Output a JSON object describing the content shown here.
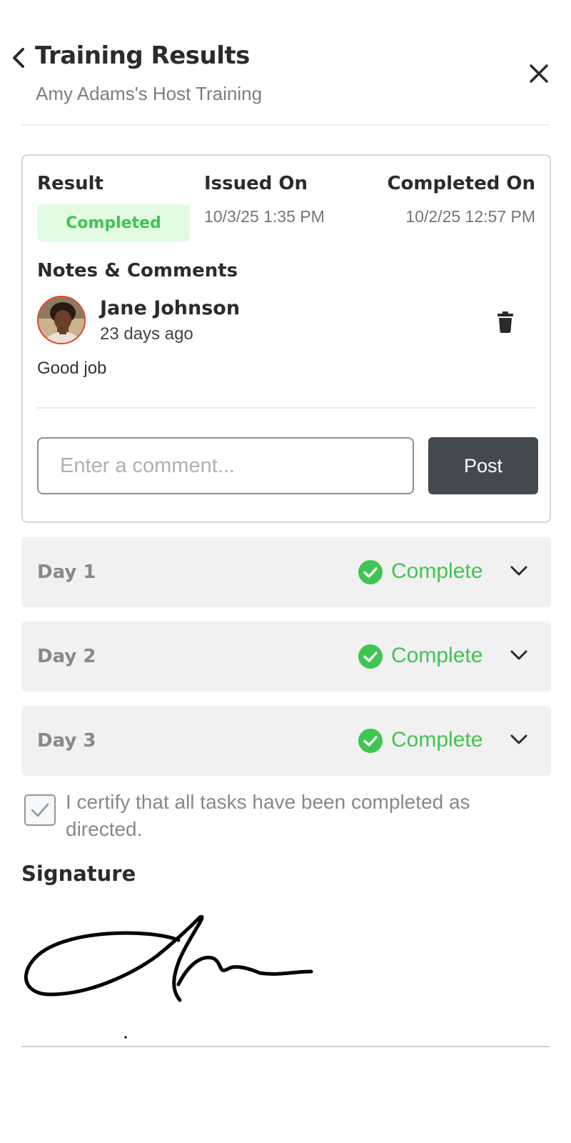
{
  "header": {
    "title": "Training Results",
    "subtitle": "Amy Adams's Host Training",
    "back_icon": "chevron-left-icon",
    "close_icon": "close-icon"
  },
  "result_card": {
    "result_label": "Result",
    "result_value": "Completed",
    "issued_label": "Issued On",
    "issued_value": "10/3/25 1:35 PM",
    "completed_label": "Completed On",
    "completed_value": "10/2/25 12:57 PM",
    "notes_heading": "Notes & Comments",
    "comment": {
      "author": "Jane Johnson",
      "time_ago": "23 days ago",
      "body": "Good job"
    },
    "comment_input_placeholder": "Enter a comment...",
    "post_label": "Post"
  },
  "days": [
    {
      "label": "Day 1",
      "status": "Complete"
    },
    {
      "label": "Day 2",
      "status": "Complete"
    },
    {
      "label": "Day 3",
      "status": "Complete"
    }
  ],
  "certification": {
    "checked": true,
    "text": "I certify that all tasks have been completed as directed."
  },
  "signature": {
    "heading": "Signature"
  },
  "colors": {
    "accent_green": "#3fc552",
    "pill_bg": "#e3fbe3",
    "post_button": "#424a50",
    "day_row_bg": "#f1f1f1",
    "avatar_border": "#d9452b"
  }
}
